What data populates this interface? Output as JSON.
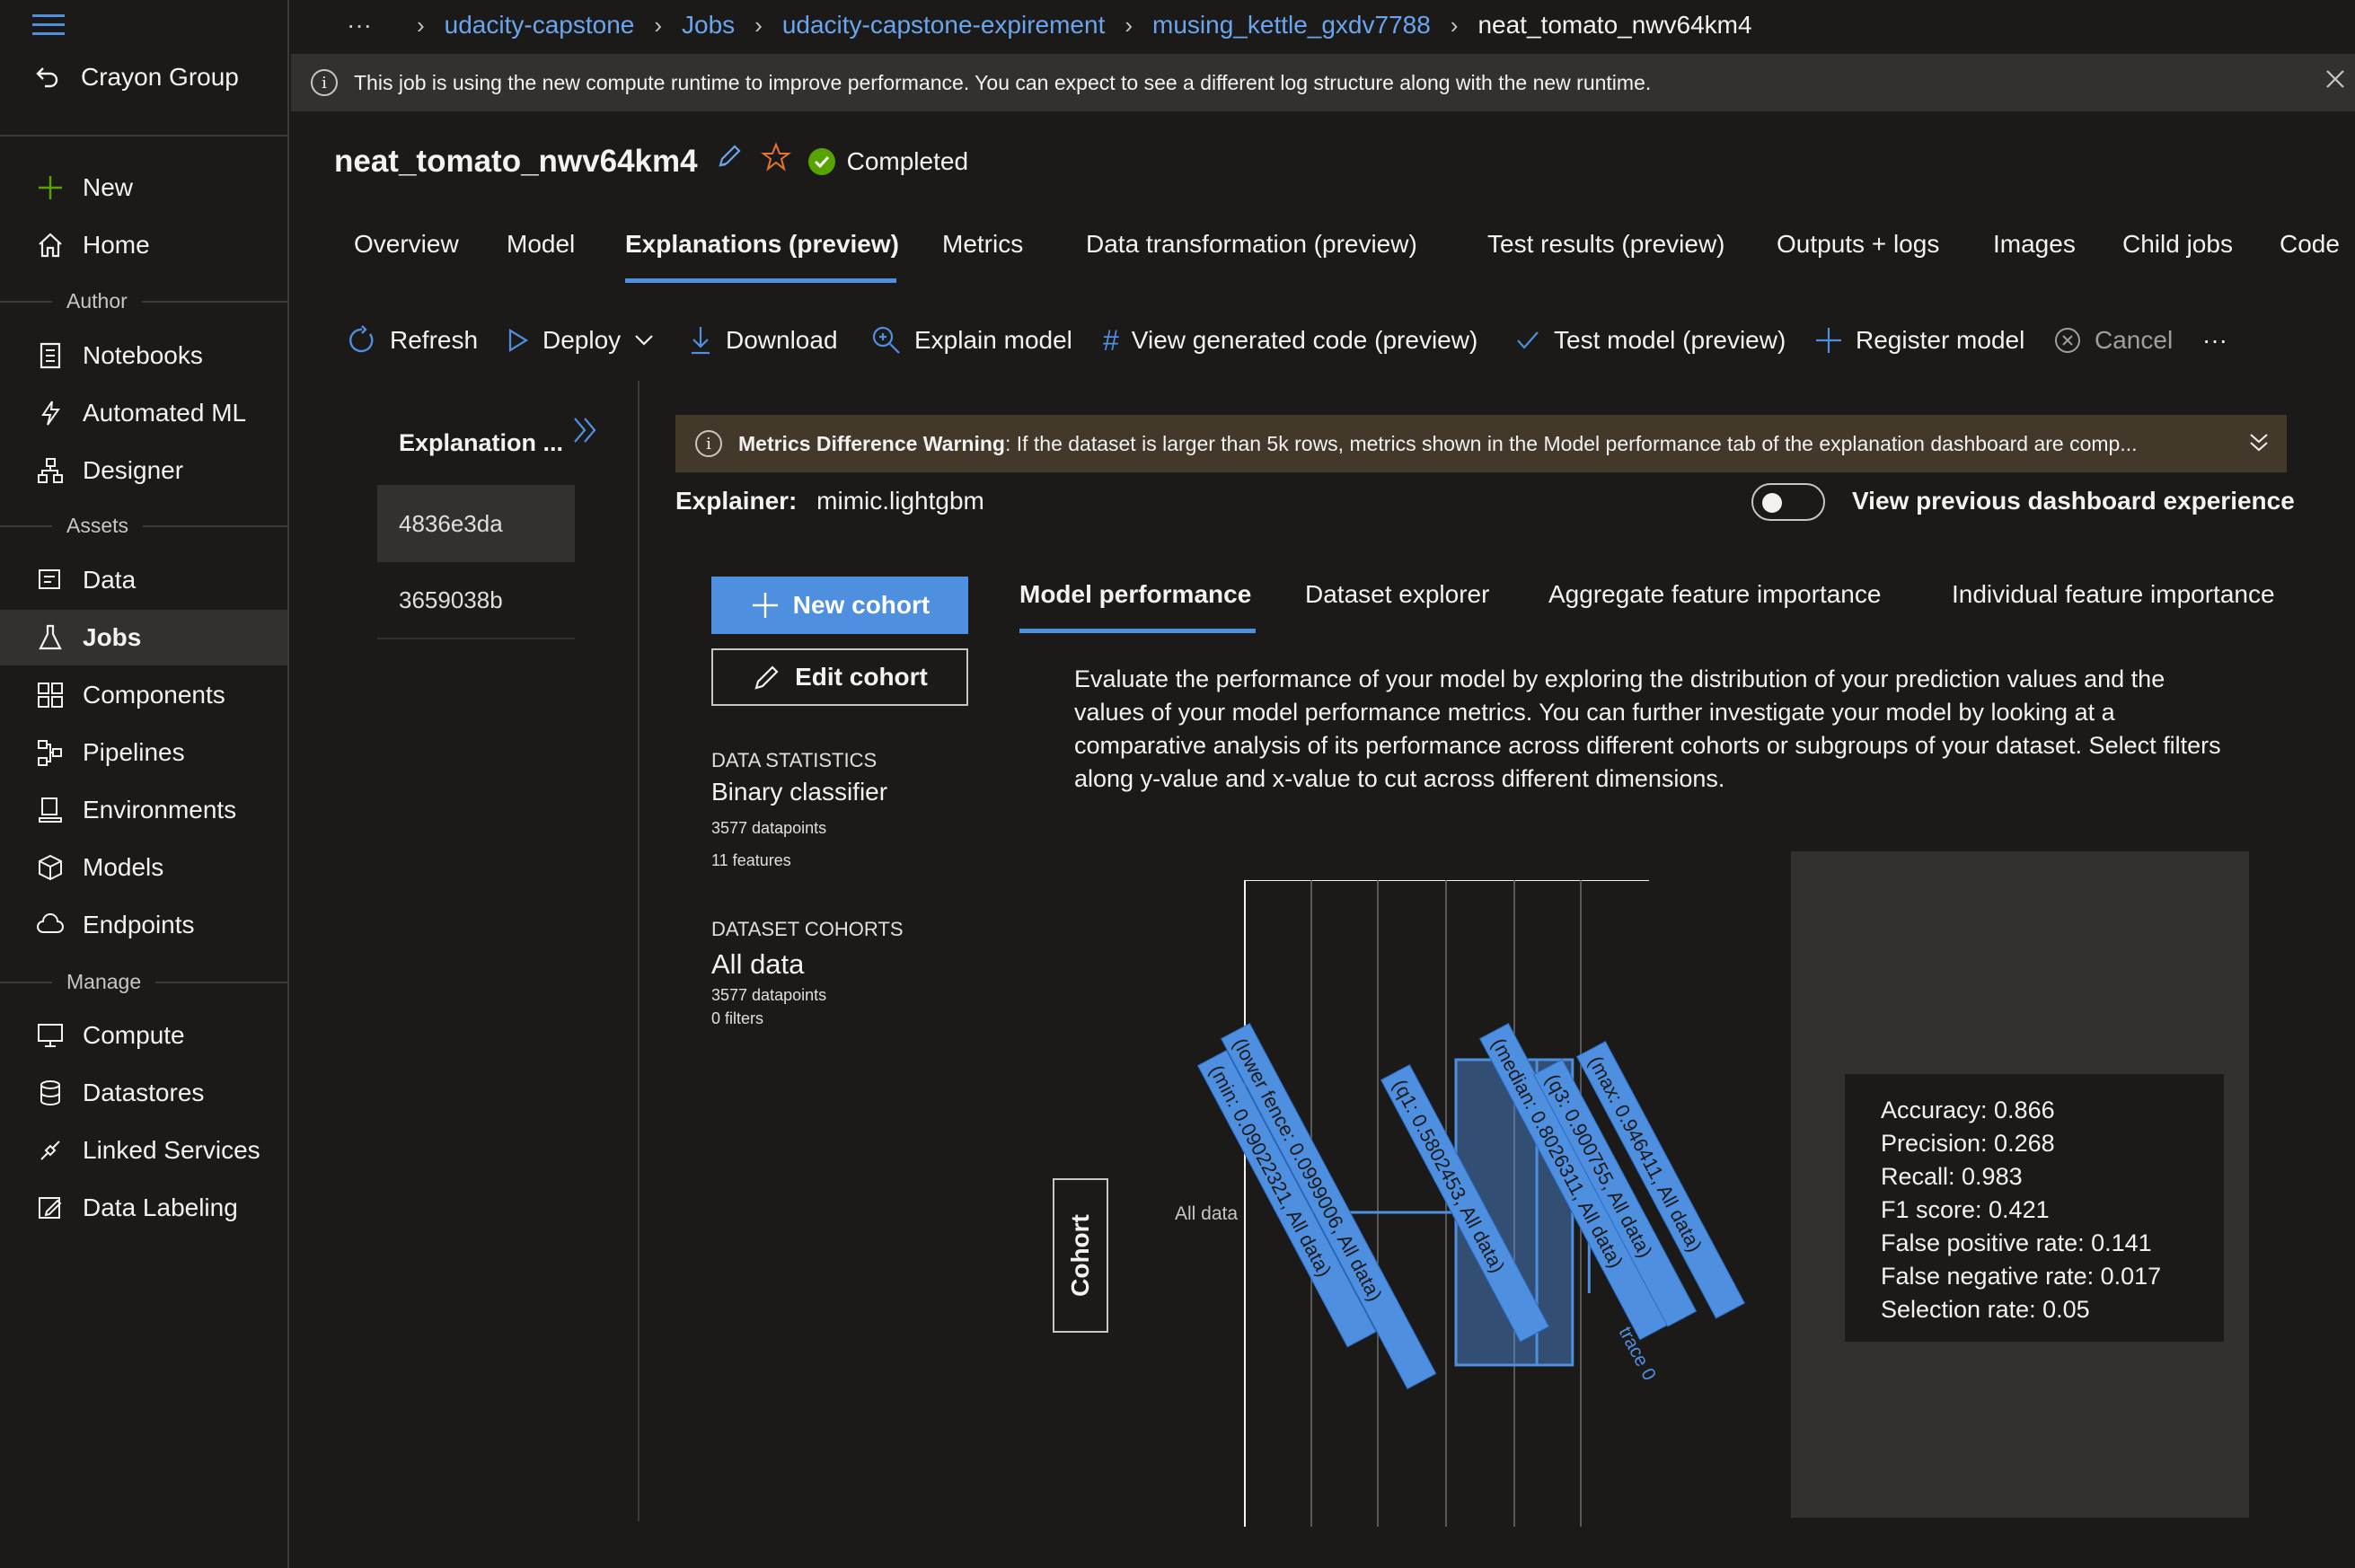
{
  "workspace": "Crayon Group",
  "sidebar": {
    "top_items": [
      {
        "label": "New",
        "icon": "plus-icon"
      },
      {
        "label": "Home",
        "icon": "home-icon"
      }
    ],
    "groups": [
      {
        "label": "Author",
        "items": [
          "Notebooks",
          "Automated ML",
          "Designer"
        ]
      },
      {
        "label": "Assets",
        "items": [
          "Data",
          "Jobs",
          "Components",
          "Pipelines",
          "Environments",
          "Models",
          "Endpoints"
        ]
      },
      {
        "label": "Manage",
        "items": [
          "Compute",
          "Datastores",
          "Linked Services",
          "Data Labeling"
        ]
      }
    ],
    "active": "Jobs"
  },
  "breadcrumb": {
    "more": "···",
    "items": [
      "udacity-capstone",
      "Jobs",
      "udacity-capstone-expirement",
      "musing_kettle_gxdv7788"
    ],
    "current": "neat_tomato_nwv64km4"
  },
  "info_banner": "This job is using the new compute runtime to improve performance. You can expect to see a different log structure along with the new runtime.",
  "job": {
    "title": "neat_tomato_nwv64km4",
    "status": "Completed"
  },
  "tabs": [
    "Overview",
    "Model",
    "Explanations (preview)",
    "Metrics",
    "Data transformation (preview)",
    "Test results (preview)",
    "Outputs + logs",
    "Images",
    "Child jobs",
    "Code"
  ],
  "active_tab": "Explanations (preview)",
  "toolbar": {
    "refresh": "Refresh",
    "deploy": "Deploy",
    "download": "Download",
    "explain": "Explain model",
    "view_code": "View generated code (preview)",
    "test_model": "Test model (preview)",
    "register": "Register model",
    "cancel": "Cancel",
    "more": "···"
  },
  "explanations": {
    "header": "Explanation ...",
    "items": [
      "4836e3da",
      "3659038b"
    ]
  },
  "warning": {
    "bold": "Metrics Difference Warning",
    "text": ": If the dataset is larger than 5k rows, metrics shown in the Model performance tab of the explanation dashboard are comp..."
  },
  "explainer": {
    "label": "Explainer:",
    "value": "mimic.lightgbm"
  },
  "previous_dashboard": {
    "label": "View previous dashboard experience",
    "enabled": false
  },
  "cohort_buttons": {
    "new": "New cohort",
    "edit": "Edit cohort"
  },
  "inner_tabs": [
    "Model performance",
    "Dataset explorer",
    "Aggregate feature importance",
    "Individual feature importance"
  ],
  "inner_active": "Model performance",
  "stats": {
    "data_statistics_heading": "DATA STATISTICS",
    "classifier": "Binary classifier",
    "datapoints": "3577 datapoints",
    "features": "11 features",
    "cohorts_heading": "DATASET COHORTS",
    "cohort_name": "All data",
    "cohort_datapoints": "3577 datapoints",
    "cohort_filters": "0 filters"
  },
  "description": "Evaluate the performance of your model by exploring the distribution of your prediction values and the values of your model performance metrics. You can further investigate your model by looking at a comparative analysis of its performance across different cohorts or subgroups of your dataset. Select filters along y-value and x-value to cut across different dimensions.",
  "chart": {
    "y_button": "Cohort",
    "y_tick": "All data",
    "trace_label": "trace 0",
    "hover_labels": [
      "(lower fence: 0.0999006, All data)",
      "(min: 0.09022321, All data)",
      "(q1: 0.5802453, All data)",
      "(median: 0.8026311, All data)",
      "(q3: 0.900755, All data)",
      "(max: 0.946411, All data)"
    ]
  },
  "chart_data": {
    "type": "box",
    "orientation": "horizontal",
    "category": "All data",
    "series": [
      {
        "name": "trace 0",
        "lower_fence": 0.0999006,
        "min": 0.09022321,
        "q1": 0.5802453,
        "median": 0.8026311,
        "q3": 0.900755,
        "max": 0.946411
      }
    ]
  },
  "metrics": [
    "Accuracy: 0.866",
    "Precision: 0.268",
    "Recall: 0.983",
    "F1 score: 0.421",
    "False positive rate: 0.141",
    "False negative rate: 0.017",
    "Selection rate: 0.05"
  ],
  "colors": {
    "accent": "#4f8fe0",
    "status_success": "#57a300",
    "background": "#1b1a19",
    "panel": "#323130",
    "warning_bg": "#42392a",
    "star": "#e8742e"
  }
}
